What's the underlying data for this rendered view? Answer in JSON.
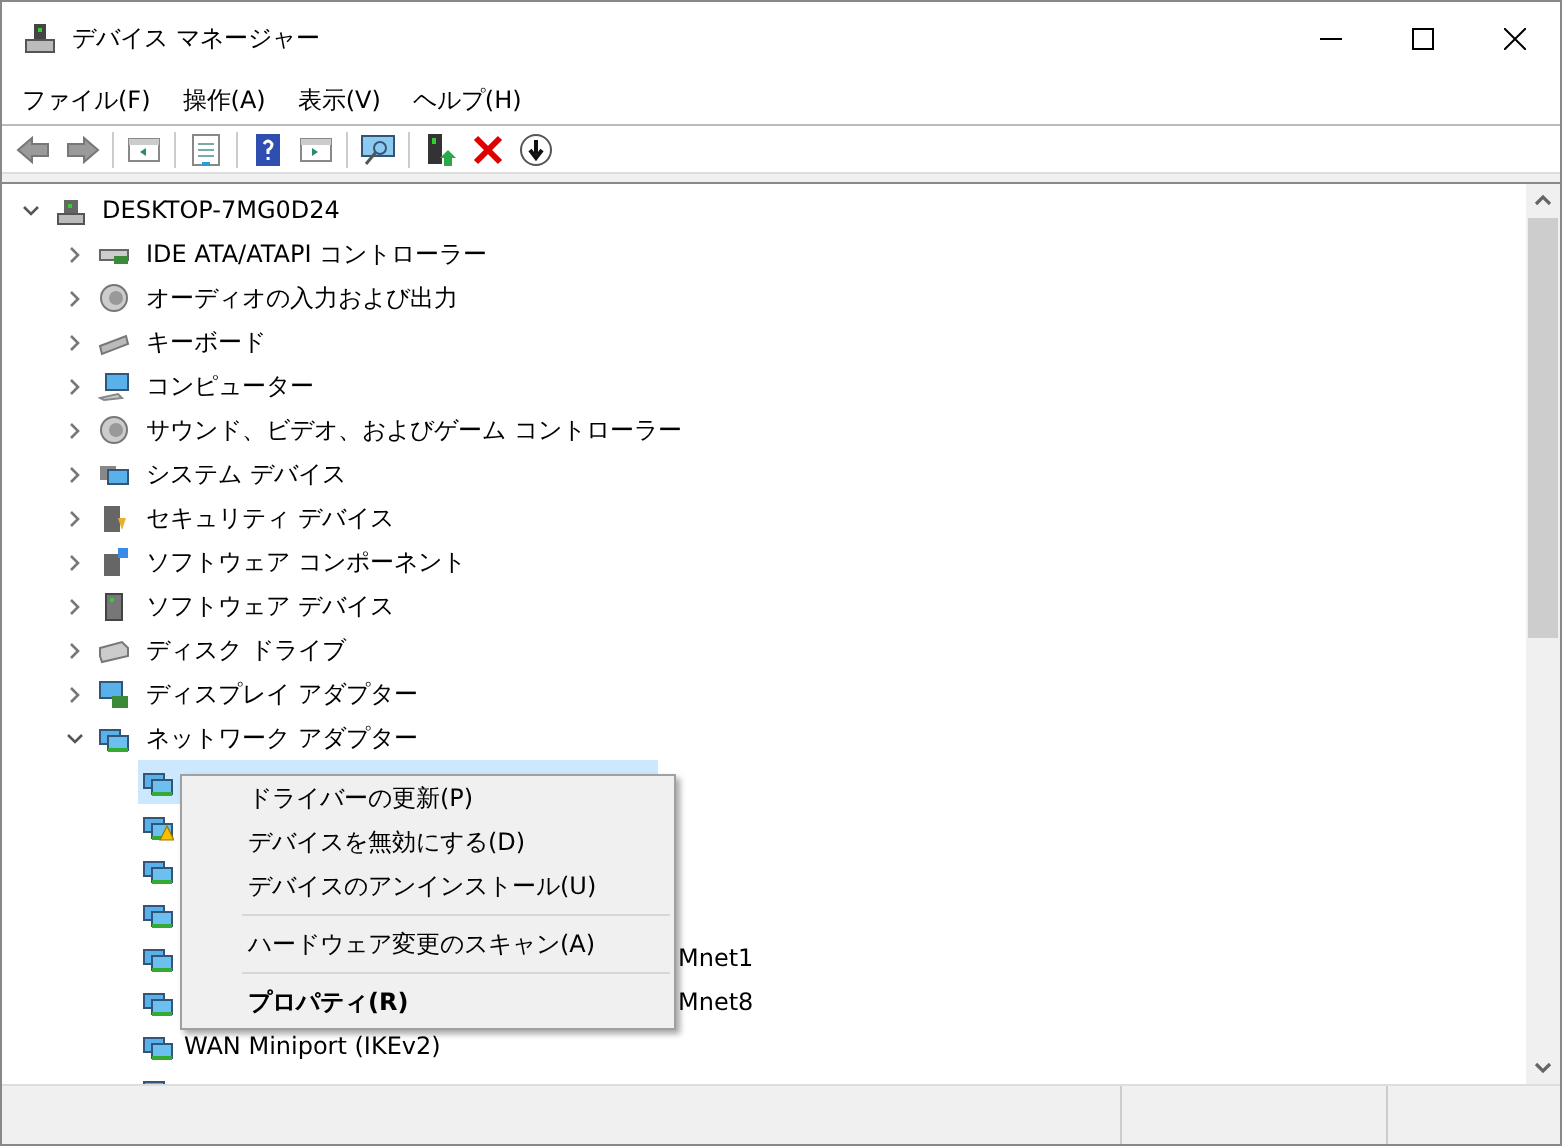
{
  "window": {
    "title": "デバイス マネージャー"
  },
  "menu": [
    "ファイル(F)",
    "操作(A)",
    "表示(V)",
    "ヘルプ(H)"
  ],
  "tree": {
    "label": "DESKTOP-7MG0D24",
    "kind": "computer",
    "expanded": true,
    "children": [
      {
        "label": "IDE ATA/ATAPI コントローラー",
        "kind": "ide",
        "expanded": false
      },
      {
        "label": "オーディオの入力および出力",
        "kind": "audio",
        "expanded": false
      },
      {
        "label": "キーボード",
        "kind": "keyboard",
        "expanded": false
      },
      {
        "label": "コンピューター",
        "kind": "monitor",
        "expanded": false
      },
      {
        "label": "サウンド、ビデオ、およびゲーム コントローラー",
        "kind": "audio",
        "expanded": false
      },
      {
        "label": "システム デバイス",
        "kind": "system",
        "expanded": false
      },
      {
        "label": "セキュリティ デバイス",
        "kind": "security",
        "expanded": false
      },
      {
        "label": "ソフトウェア コンポーネント",
        "kind": "component",
        "expanded": false
      },
      {
        "label": "ソフトウェア デバイス",
        "kind": "device",
        "expanded": false
      },
      {
        "label": "ディスク ドライブ",
        "kind": "disk",
        "expanded": false
      },
      {
        "label": "ディスプレイ アダプター",
        "kind": "display",
        "expanded": false
      },
      {
        "label": "ネットワーク アダプター",
        "kind": "network",
        "expanded": true,
        "children": [
          {
            "kind": "network",
            "selected": true,
            "warning": false
          },
          {
            "kind": "network",
            "selected": false,
            "warning": true
          },
          {
            "kind": "network",
            "selected": false,
            "warning": false
          },
          {
            "kind": "network",
            "selected": false,
            "warning": false
          },
          {
            "label": "Mnet1",
            "obscured": true,
            "kind": "network",
            "selected": false,
            "warning": false
          },
          {
            "label": "Mnet8",
            "obscured": true,
            "kind": "network",
            "selected": false,
            "warning": false
          },
          {
            "label": "WAN Miniport (IKEv2)",
            "kind": "network",
            "selected": false,
            "warning": false
          },
          {
            "kind": "network",
            "selected": false
          }
        ]
      }
    ]
  },
  "context_menu": [
    {
      "label": "ドライバーの更新(P)",
      "kind": "item",
      "bold": false
    },
    {
      "label": "デバイスを無効にする(D)",
      "kind": "item",
      "bold": false
    },
    {
      "label": "デバイスのアンインストール(U)",
      "kind": "item",
      "bold": false
    },
    {
      "kind": "separator"
    },
    {
      "label": "ハードウェア変更のスキャン(A)",
      "kind": "item",
      "bold": false
    },
    {
      "kind": "separator"
    },
    {
      "label": "プロパティ(R)",
      "kind": "item",
      "bold": true
    }
  ]
}
